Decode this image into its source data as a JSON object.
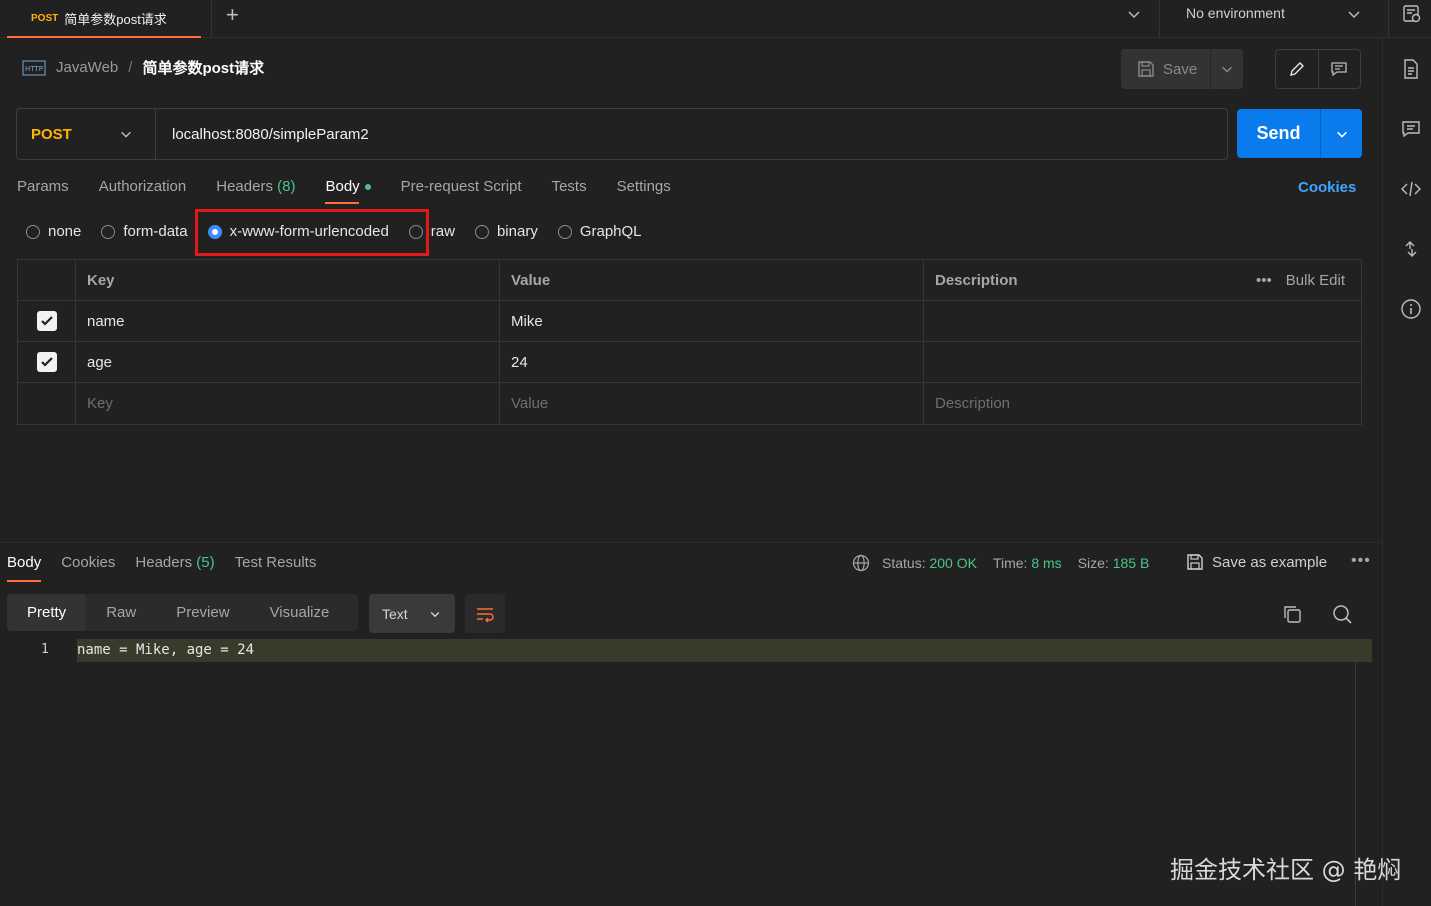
{
  "tabbar": {
    "tab_method": "POST",
    "tab_title": "简单参数post请求",
    "add_tab": "+",
    "environment": "No environment"
  },
  "breadcrumb": {
    "collection": "JavaWeb",
    "separator": "/",
    "request": "简单参数post请求"
  },
  "toolbar": {
    "save_label": "Save"
  },
  "request": {
    "method": "POST",
    "url": "localhost:8080/simpleParam2",
    "send_label": "Send"
  },
  "request_tabs": {
    "params": "Params",
    "authorization": "Authorization",
    "headers": "Headers",
    "headers_count": "(8)",
    "body": "Body",
    "prerequest": "Pre-request Script",
    "tests": "Tests",
    "settings": "Settings",
    "cookies": "Cookies"
  },
  "body_types": {
    "none": "none",
    "form_data": "form-data",
    "urlencoded": "x-www-form-urlencoded",
    "raw": "raw",
    "binary": "binary",
    "graphql": "GraphQL",
    "selected": "x-www-form-urlencoded"
  },
  "params_table": {
    "headers": {
      "key": "Key",
      "value": "Value",
      "description": "Description",
      "bulk_edit": "Bulk Edit"
    },
    "rows": [
      {
        "key": "name",
        "value": "Mike",
        "checked": true
      },
      {
        "key": "age",
        "value": "24",
        "checked": true
      }
    ],
    "placeholders": {
      "key": "Key",
      "value": "Value",
      "description": "Description"
    }
  },
  "response_tabs": {
    "body": "Body",
    "cookies": "Cookies",
    "headers": "Headers",
    "headers_count": "(5)",
    "test_results": "Test Results"
  },
  "response_status": {
    "status_label": "Status:",
    "status_value": "200 OK",
    "time_label": "Time:",
    "time_value": "8 ms",
    "size_label": "Size:",
    "size_value": "185 B",
    "save_example": "Save as example"
  },
  "response_view": {
    "pretty": "Pretty",
    "raw": "Raw",
    "preview": "Preview",
    "visualize": "Visualize",
    "format": "Text"
  },
  "response_code": {
    "line_number": "1",
    "line_text": "name = Mike, age = 24"
  },
  "watermark": "掘金技术社区 @ 艳焖",
  "colors": {
    "accent_orange": "#ff6c37",
    "method_yellow": "#ffb400",
    "send_blue": "#097bed",
    "status_green": "#49c58a",
    "highlight_red": "#e0191b"
  }
}
